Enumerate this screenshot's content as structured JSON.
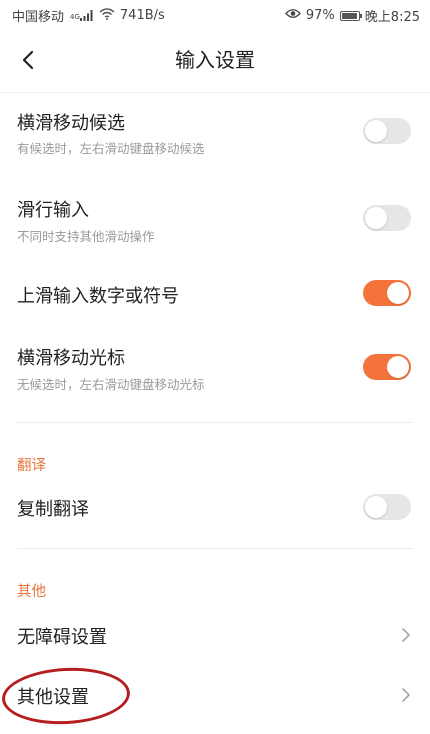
{
  "status_bar": {
    "carrier": "中国移动",
    "network_type": "4G",
    "speed": "741B/s",
    "battery_percent": "97%",
    "battery_level": 0.97,
    "time": "晚上8:25"
  },
  "header": {
    "title": "输入设置"
  },
  "settings": [
    {
      "title": "横滑移动候选",
      "subtitle": "有候选时，左右滑动键盘移动候选",
      "enabled": false
    },
    {
      "title": "滑行输入",
      "subtitle": "不同时支持其他滑动操作",
      "enabled": false
    },
    {
      "title": "上滑输入数字或符号",
      "subtitle": "",
      "enabled": true
    },
    {
      "title": "横滑移动光标",
      "subtitle": "无候选时，左右滑动键盘移动光标",
      "enabled": true
    }
  ],
  "translate_section": {
    "label": "翻译",
    "items": [
      {
        "title": "复制翻译",
        "enabled": false
      }
    ]
  },
  "other_section": {
    "label": "其他",
    "items": [
      {
        "title": "无障碍设置"
      },
      {
        "title": "其他设置"
      }
    ]
  },
  "colors": {
    "accent": "#f4733a",
    "section_label": "#e8763c",
    "annotation": "#b41e1e"
  }
}
